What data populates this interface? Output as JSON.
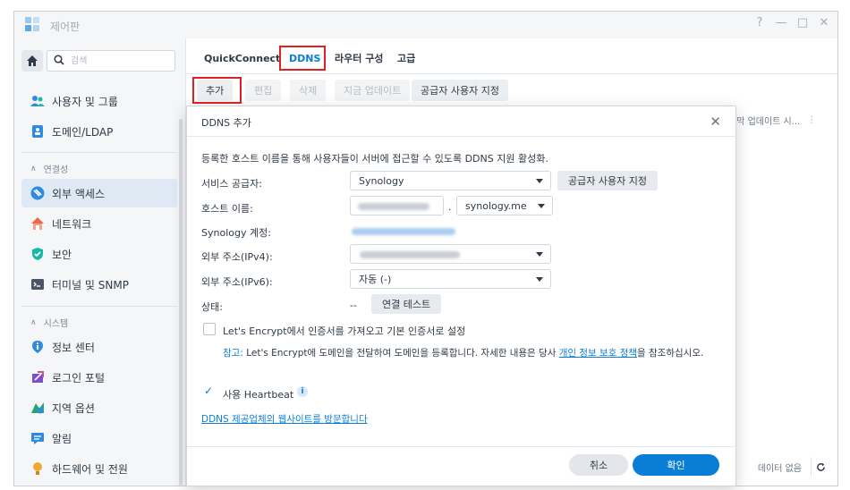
{
  "window": {
    "title": "제어판",
    "controls": [
      "?",
      "—",
      "□",
      "✕"
    ]
  },
  "sidebar": {
    "search_placeholder": "검색",
    "items": [
      {
        "label": "사용자 및 그룹",
        "icon": "users-icon",
        "color": "#2f8be0"
      },
      {
        "label": "도메인/LDAP",
        "icon": "domain-icon",
        "color": "#2f8be0"
      }
    ],
    "sections": [
      {
        "title": "연결성",
        "items": [
          {
            "label": "외부 액세스",
            "icon": "external-access-icon",
            "color": "#2f8be0",
            "active": true
          },
          {
            "label": "네트워크",
            "icon": "network-icon",
            "color": "#e86a4a"
          },
          {
            "label": "보안",
            "icon": "security-shield-icon",
            "color": "#17b8a6"
          },
          {
            "label": "터미널 및 SNMP",
            "icon": "terminal-icon",
            "color": "#4a5665"
          }
        ]
      },
      {
        "title": "시스템",
        "items": [
          {
            "label": "정보 센터",
            "icon": "info-center-icon",
            "color": "#2f8be0"
          },
          {
            "label": "로그인 포털",
            "icon": "login-portal-icon",
            "color": "#7b4fc8"
          },
          {
            "label": "지역 옵션",
            "icon": "regional-options-icon",
            "color": "#27a66c"
          },
          {
            "label": "알림",
            "icon": "notification-icon",
            "color": "#2f8be0"
          },
          {
            "label": "하드웨어 및 전원",
            "icon": "hardware-power-icon",
            "color": "#f0a830"
          }
        ]
      }
    ]
  },
  "main": {
    "tabs": [
      "QuickConnect",
      "DDNS",
      "라우터 구성",
      "고급"
    ],
    "active_tab": "DDNS",
    "toolbar": {
      "add": "추가",
      "edit": "편집",
      "delete": "삭제",
      "update_now": "지금 업데이트",
      "custom_provider": "공급자 사용자 지정"
    },
    "column_header": "지막 업데이트 시...",
    "column_more": "⋮",
    "no_data": "데이터 없음"
  },
  "modal": {
    "title": "DDNS 추가",
    "description": "등록한 호스트 이름을 통해 사용자들이 서버에 접근할 수 있도록 DDNS 지원 활성화.",
    "service_provider_label": "서비스 공급자:",
    "service_provider_value": "Synology",
    "custom_provider_btn": "공급자 사용자 지정",
    "hostname_label": "호스트 이름:",
    "hostname_separator": ".",
    "domain_value": "synology.me",
    "account_label": "Synology 계정:",
    "ipv4_label": "외부 주소(IPv4):",
    "ipv6_label": "외부 주소(IPv6):",
    "ipv6_value": "자동 (-)",
    "status_label": "상태:",
    "status_value": "--",
    "test_connection": "연결 테스트",
    "letsencrypt_label": "Let's Encrypt에서 인증서를 가져오고 기본 인증서로 설정",
    "letsencrypt_checked": false,
    "note_prefix": "참고:",
    "note_text": " Let's Encrypt에 도메인을 전달하여 도메인을 등록합니다. 자세한 내용은 당사 ",
    "note_link": "개인 정보 보호 정책",
    "note_suffix": "을 참조하십시오.",
    "heartbeat_label": "사용 Heartbeat",
    "heartbeat_checked": true,
    "provider_site_link": "DDNS 제공업체의 웹사이트를 방문합니다",
    "cancel": "취소",
    "ok": "확인",
    "close": "✕"
  },
  "colors": {
    "accent": "#0a7ed7",
    "highlight": "#e02020"
  }
}
